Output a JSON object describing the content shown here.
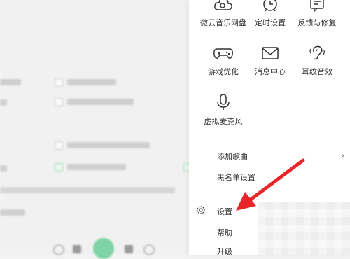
{
  "menu": {
    "tools_row1": [
      {
        "label": "微云音乐网盘",
        "icon": "cloud-icon"
      },
      {
        "label": "定时设置",
        "icon": "alarm-clock-icon"
      },
      {
        "label": "反馈与修复",
        "icon": "feedback-icon"
      }
    ],
    "tools_row2": [
      {
        "label": "游戏优化",
        "icon": "gamepad-icon"
      },
      {
        "label": "消息中心",
        "icon": "envelope-icon"
      },
      {
        "label": "耳纹音效",
        "icon": "ear-icon"
      }
    ],
    "tools_row3": [
      {
        "label": "虚拟麦克风",
        "icon": "microphone-icon"
      }
    ],
    "items": {
      "add_song": "添加歌曲",
      "blacklist": "黑名单设置",
      "settings": "设置",
      "help": "帮助",
      "upgrade": "升级"
    }
  },
  "colors": {
    "arrow": "#e8262a",
    "accent_green": "#31c27c"
  }
}
